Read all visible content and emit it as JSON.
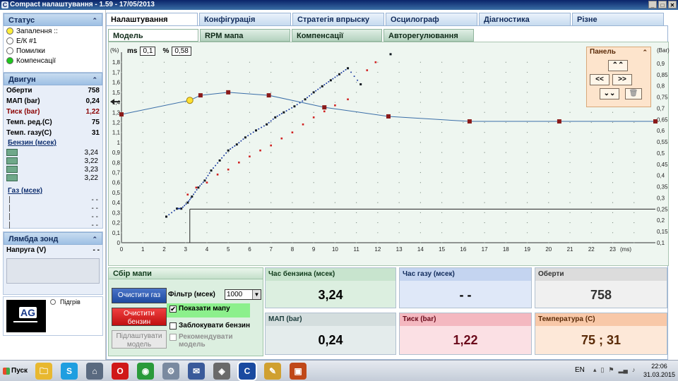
{
  "window": {
    "title": "Compact налаштування - 1.59 - 17/05/2013",
    "icon_name": "compact-app-icon",
    "controls": [
      "_",
      "□",
      "✕"
    ]
  },
  "sidebar": {
    "status": {
      "title": "Статус",
      "items": [
        {
          "label": "Запалення ::",
          "color": "#ffef3a"
        },
        {
          "label": "Е/К #1",
          "color": "#ffffff"
        },
        {
          "label": "Помилки",
          "color": "#ffffff"
        },
        {
          "label": "Компенсації",
          "color": "#1ec81e"
        }
      ]
    },
    "dvygun": {
      "title": "Двигун",
      "rows": [
        {
          "label": "Оберти",
          "value": "758",
          "red": false
        },
        {
          "label": "МАП (bar)",
          "value": "0,24",
          "red": false
        },
        {
          "label": "Тиск (bar)",
          "value": "1,22",
          "red": true
        },
        {
          "label": "Темп. ред.(C)",
          "value": "75",
          "red": false
        },
        {
          "label": "Темп. газу(C)",
          "value": "31",
          "red": false
        }
      ],
      "benzin_label": "Бензин (мсек)",
      "benzin_values": [
        "3,24",
        "3,22",
        "3,23",
        "3,22"
      ],
      "gaz_label": "Газ (мсек)",
      "gaz_values": [
        "- -",
        "- -",
        "- -",
        "- -"
      ]
    },
    "lambda": {
      "title": "Лямбда зонд",
      "napruga_label": "Напруга (V)",
      "napruga_value": "- -"
    },
    "logo": {
      "text": "AG",
      "pidgriv_label": "Підгрів"
    }
  },
  "main_tabs": [
    "Налаштування",
    "Конфігурація",
    "Стратегія впрыску",
    "Осцилограф",
    "Діагностика",
    "Різне"
  ],
  "main_tab_widths": [
    130,
    130,
    130,
    130,
    130,
    130
  ],
  "sub_tabs": [
    "Модель",
    "RPM мапа",
    "Компенсації",
    "Авторегулювання"
  ],
  "chart_header": {
    "ms_label": "ms",
    "ms_value": "0,1",
    "pct_label": "%",
    "pct_value": "0,58"
  },
  "panel": {
    "title": "Панель",
    "buttons": [
      "⌃⌃",
      "<<",
      ">>",
      "⌄⌄",
      "🗑"
    ]
  },
  "chart_data": {
    "type": "scatter",
    "x_label": "(ms)",
    "y_left_label": "(%)",
    "y_right_label": "(Bar)",
    "xlim": [
      0,
      25
    ],
    "ylim_left": [
      0,
      1.9
    ],
    "ylim_right": [
      0.1,
      0.95
    ],
    "x_ticks": [
      0,
      1,
      2,
      3,
      4,
      5,
      6,
      7,
      8,
      9,
      10,
      11,
      12,
      13,
      14,
      15,
      16,
      17,
      18,
      19,
      20,
      21,
      22,
      23
    ],
    "y_left_ticks": [
      "0",
      "0,1",
      "0,2",
      "0,3",
      "0,4",
      "0,5",
      "0,6",
      "0,7",
      "0,8",
      "0,9",
      "1",
      "1,1",
      "1,2",
      "1,3",
      "1,4",
      "1,5",
      "1,6",
      "1,7",
      "1,8"
    ],
    "y_right_ticks": [
      "0,1",
      "0,15",
      "0,2",
      "0,25",
      "0,3",
      "0,35",
      "0,4",
      "0,45",
      "0,5",
      "0,55",
      "0,6",
      "0,65",
      "0,7",
      "0,75",
      "0,8",
      "0,85",
      "0,9"
    ],
    "model_curve": [
      [
        0,
        1.28
      ],
      [
        3.2,
        1.42
      ],
      [
        3.7,
        1.47
      ],
      [
        5,
        1.5
      ],
      [
        6.9,
        1.47
      ],
      [
        9.5,
        1.35
      ],
      [
        12.5,
        1.26
      ],
      [
        16.3,
        1.21
      ],
      [
        20.5,
        1.21
      ],
      [
        25,
        1.21
      ]
    ],
    "model_points": [
      [
        0,
        1.28
      ],
      [
        3.7,
        1.47
      ],
      [
        5,
        1.5
      ],
      [
        6.9,
        1.47
      ],
      [
        9.5,
        1.35
      ],
      [
        12.5,
        1.26
      ],
      [
        16.3,
        1.21
      ],
      [
        20.5,
        1.21
      ],
      [
        25,
        1.21
      ]
    ],
    "highlight_point": [
      3.2,
      1.42
    ],
    "series_black": [
      [
        2.1,
        0.26
      ],
      [
        2.6,
        0.34
      ],
      [
        2.8,
        0.34
      ],
      [
        3.1,
        0.4
      ],
      [
        3.3,
        0.46
      ],
      [
        3.6,
        0.55
      ],
      [
        3.9,
        0.62
      ],
      [
        4.2,
        0.72
      ],
      [
        4.6,
        0.82
      ],
      [
        5,
        0.92
      ],
      [
        5.4,
        0.98
      ],
      [
        5.8,
        1.05
      ],
      [
        6.3,
        1.12
      ],
      [
        6.8,
        1.18
      ],
      [
        7.2,
        1.25
      ],
      [
        7.6,
        1.3
      ],
      [
        8.1,
        1.36
      ],
      [
        8.6,
        1.43
      ],
      [
        9,
        1.5
      ],
      [
        9.4,
        1.56
      ],
      [
        9.8,
        1.62
      ],
      [
        10.2,
        1.68
      ],
      [
        10.6,
        1.74
      ],
      [
        11.2,
        1.58
      ],
      [
        12.6,
        1.88
      ]
    ],
    "series_red": [
      [
        3.1,
        0.48
      ],
      [
        3.5,
        0.55
      ],
      [
        4,
        0.6
      ],
      [
        4.5,
        0.68
      ],
      [
        5,
        0.73
      ],
      [
        5.5,
        0.8
      ],
      [
        6,
        0.86
      ],
      [
        6.5,
        0.92
      ],
      [
        7,
        0.97
      ],
      [
        7.5,
        1.04
      ],
      [
        8,
        1.1
      ],
      [
        8.5,
        1.18
      ],
      [
        9,
        1.25
      ],
      [
        9.5,
        1.31
      ],
      [
        10,
        1.37
      ],
      [
        10.6,
        1.43
      ],
      [
        11.5,
        1.72
      ],
      [
        11.9,
        1.8
      ]
    ],
    "crosshair": {
      "x": 3.2,
      "y_right": 0.25
    }
  },
  "sbir": {
    "title": "Сбір мапи",
    "clear_gas_label": "Очистити газ",
    "clear_benzin_label": "Очистити бензин",
    "adjust_model_label": "Підлаштувати модель",
    "filter_label": "Фільтр (мсек)",
    "filter_value": "1000",
    "show_map_label": "Показати мапу",
    "show_map_checked": "✔",
    "block_benzin_label": "Заблокувати бензин",
    "recommend_label": "Рекомендувати модель"
  },
  "info_panels": {
    "chas_benzina": {
      "label": "Час бензина (мсек)",
      "value": "3,24"
    },
    "chas_gazu": {
      "label": "Час газу (мсек)",
      "value": "- -"
    },
    "oberty": {
      "label": "Оберти",
      "value": "758"
    },
    "map": {
      "label": "МАП (bar)",
      "value": "0,24"
    },
    "tysk": {
      "label": "Тиск (bar)",
      "value": "1,22"
    },
    "temperatura": {
      "label": "Температура (C)",
      "value": "75 ; 31"
    }
  },
  "taskbar": {
    "start_label": "Пуск",
    "apps": [
      {
        "name": "explorer-icon",
        "glyph": "🗀",
        "color": "#e8b830"
      },
      {
        "name": "skype-icon",
        "glyph": "S",
        "color": "#1e9ee0"
      },
      {
        "name": "network-icon",
        "glyph": "⌂",
        "color": "#5a6a80"
      },
      {
        "name": "opera-icon",
        "glyph": "O",
        "color": "#d01818"
      },
      {
        "name": "chrome-icon",
        "glyph": "◉",
        "color": "#2a9a3a"
      },
      {
        "name": "settings-icon",
        "glyph": "⚙",
        "color": "#7a8aa0"
      },
      {
        "name": "utility-icon",
        "glyph": "✉",
        "color": "#3a5a9a"
      },
      {
        "name": "tool-icon",
        "glyph": "◈",
        "color": "#6a6a6a"
      },
      {
        "name": "compact-taskbar-icon",
        "glyph": "C",
        "color": "#1a4aa0"
      },
      {
        "name": "paint-icon",
        "glyph": "✎",
        "color": "#d0a030"
      },
      {
        "name": "app-icon",
        "glyph": "▣",
        "color": "#c04818"
      }
    ],
    "lang": "EN",
    "time": "22:06",
    "date": "31.03.2015"
  }
}
